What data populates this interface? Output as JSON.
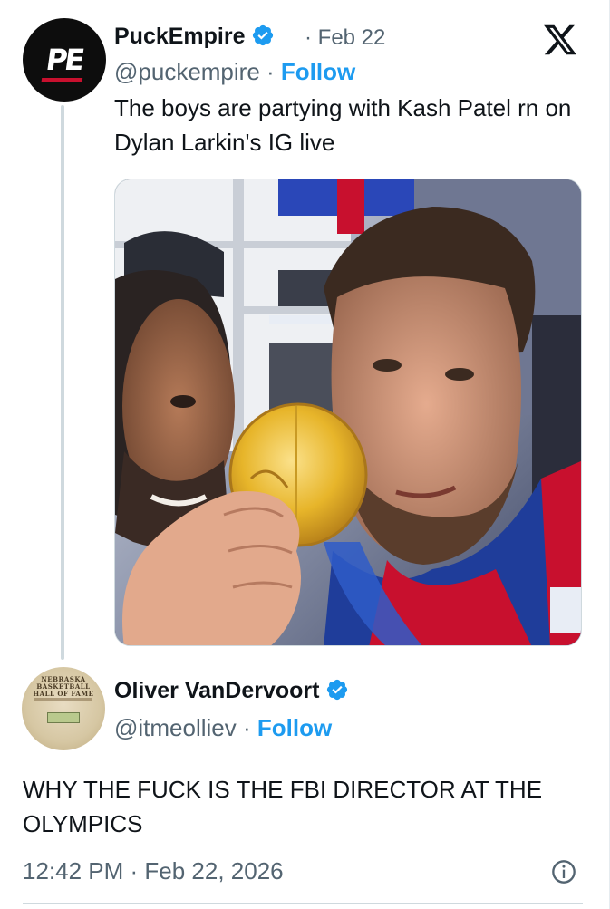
{
  "quoted_tweet": {
    "avatar_text": "PE",
    "display_name": "PuckEmpire",
    "date": "· Feb 22",
    "handle": "@puckempire",
    "separator": " · ",
    "follow_label": "Follow",
    "text": "The boys are partying with Kash Patel rn on Dylan Larkin's IG live",
    "platform_icon": "x-logo-icon"
  },
  "reply_tweet": {
    "display_name": "Oliver VanDervoort",
    "handle": "@itmeolliev",
    "separator": " · ",
    "follow_label": "Follow",
    "avatar_text": "NEBRASKA BASKETBALL HALL OF FAME",
    "text": "WHY THE FUCK IS THE FBI DIRECTOR AT THE OLYMPICS",
    "timestamp": "12:42 PM · Feb 22, 2026"
  },
  "colors": {
    "text": "#0f1419",
    "secondary": "#536471",
    "accent": "#1d9bf0",
    "thread_line": "#cfd9de",
    "medal_gold": "#e7b52a"
  }
}
